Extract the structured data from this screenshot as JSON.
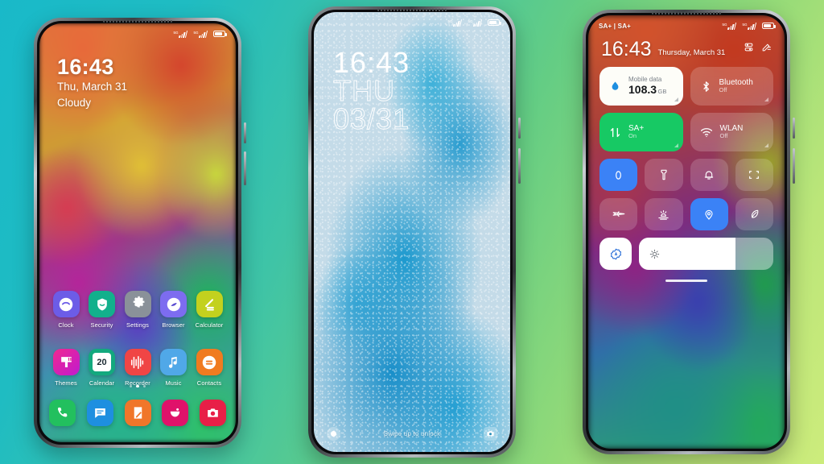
{
  "background": {
    "from": "#19b9c9",
    "to": "#cdec7c"
  },
  "phone1": {
    "name": "homescreen",
    "statusbar": {
      "left": "",
      "battery_pct": 80
    },
    "widget": {
      "time": "16:43",
      "date": "Thu, March 31",
      "weather": "Cloudy"
    },
    "apps_row1": [
      {
        "label": "Clock",
        "icon": "clock-icon",
        "bg": "#6c5ce7"
      },
      {
        "label": "Security",
        "icon": "shield-icon",
        "bg": "#12b08c"
      },
      {
        "label": "Settings",
        "icon": "gear-icon",
        "bg": "#8a9199"
      },
      {
        "label": "Browser",
        "icon": "compass-icon",
        "bg": "#7d6cf0"
      },
      {
        "label": "Calculator",
        "icon": "calculator-icon",
        "bg": "#c3d11e"
      }
    ],
    "apps_row2": [
      {
        "label": "Themes",
        "icon": "themes-icon",
        "bg": "#e0268f"
      },
      {
        "label": "Calendar",
        "icon": "calendar-icon",
        "bg": "#13a97e",
        "day": "20"
      },
      {
        "label": "Recorder",
        "icon": "waveform-icon",
        "bg": "#f04545"
      },
      {
        "label": "Music",
        "icon": "music-note-icon",
        "bg": "#50a8e8"
      },
      {
        "label": "Contacts",
        "icon": "contacts-icon",
        "bg": "#f07b20"
      }
    ],
    "dock": [
      {
        "name": "phone-icon",
        "bg": "#22c05e"
      },
      {
        "name": "messages-icon",
        "bg": "#1e8fe0"
      },
      {
        "name": "notes-icon",
        "bg": "#f0762a"
      },
      {
        "name": "gallery-icon",
        "bg": "#e0126a"
      },
      {
        "name": "camera-icon",
        "bg": "#e81f47"
      }
    ],
    "page_dots": {
      "count": 3,
      "active_index": 1
    }
  },
  "phone2": {
    "name": "lockscreen",
    "statusbar": {
      "battery_pct": 80
    },
    "lock": {
      "time": "16:43",
      "weekday": "THU",
      "date": "03/31"
    },
    "bottom": {
      "hint": "Swipe up to unlock",
      "left_icon": "flashlight-circle-icon",
      "right_icon": "camera-icon"
    }
  },
  "phone3": {
    "name": "control-center",
    "statusbar": {
      "carriers": "SA+ | SA+",
      "battery_pct": 80
    },
    "header": {
      "time": "16:43",
      "date": "Thursday, March 31",
      "actions": [
        {
          "name": "settings-sliders-icon"
        },
        {
          "name": "edit-tiles-icon"
        }
      ]
    },
    "big_tiles": [
      {
        "name": "mobile-data-tile",
        "title": "Mobile data",
        "value": "108.3",
        "unit": "GB",
        "style": "white",
        "icon": "data-drop-icon",
        "accent": "#1e8fe0"
      },
      {
        "name": "bluetooth-tile",
        "title": "Bluetooth",
        "state": "Off",
        "style": "dim",
        "icon": "bluetooth-icon"
      },
      {
        "name": "sa-plus-tile",
        "title": "SA+",
        "state": "On",
        "style": "green",
        "icon": "data-arrows-icon"
      },
      {
        "name": "wlan-tile",
        "title": "WLAN",
        "state": "Off",
        "style": "dim",
        "icon": "wifi-icon"
      }
    ],
    "small_tiles": [
      {
        "name": "rotation-lock-tile",
        "icon": "rotation-lock-icon",
        "active": true
      },
      {
        "name": "flashlight-tile",
        "icon": "flashlight-icon",
        "active": false
      },
      {
        "name": "silent-mode-tile",
        "icon": "bell-mute-icon",
        "active": false
      },
      {
        "name": "screenshot-tile",
        "icon": "screenshot-icon",
        "active": false
      },
      {
        "name": "airplane-mode-tile",
        "icon": "airplane-icon",
        "active": false
      },
      {
        "name": "reading-mode-tile",
        "icon": "sunset-icon",
        "active": false
      },
      {
        "name": "location-tile",
        "icon": "location-pin-icon",
        "active": true
      },
      {
        "name": "battery-saver-tile",
        "icon": "leaf-icon",
        "active": false
      }
    ],
    "brightness": {
      "auto_button": "auto-brightness-icon",
      "slider_icon": "brightness-sun-icon",
      "level_pct": 72
    },
    "home_indicator": true
  }
}
